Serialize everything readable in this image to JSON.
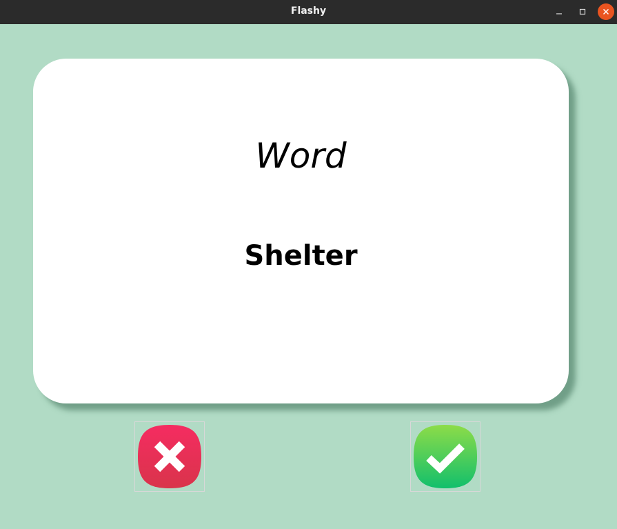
{
  "window": {
    "title": "Flashy",
    "controls": {
      "minimize_icon": "minimize-icon",
      "maximize_icon": "maximize-icon",
      "close_icon": "close-icon"
    }
  },
  "card": {
    "title": "Word",
    "word": "Shelter"
  },
  "buttons": {
    "wrong_icon": "cross-icon",
    "right_icon": "checkmark-icon"
  },
  "colors": {
    "background": "#b1dbc5",
    "card": "#ffffff",
    "wrong": "#e8345a",
    "right": "#2ec862",
    "titlebar": "#2b2b2b",
    "close_button": "#e95420"
  }
}
